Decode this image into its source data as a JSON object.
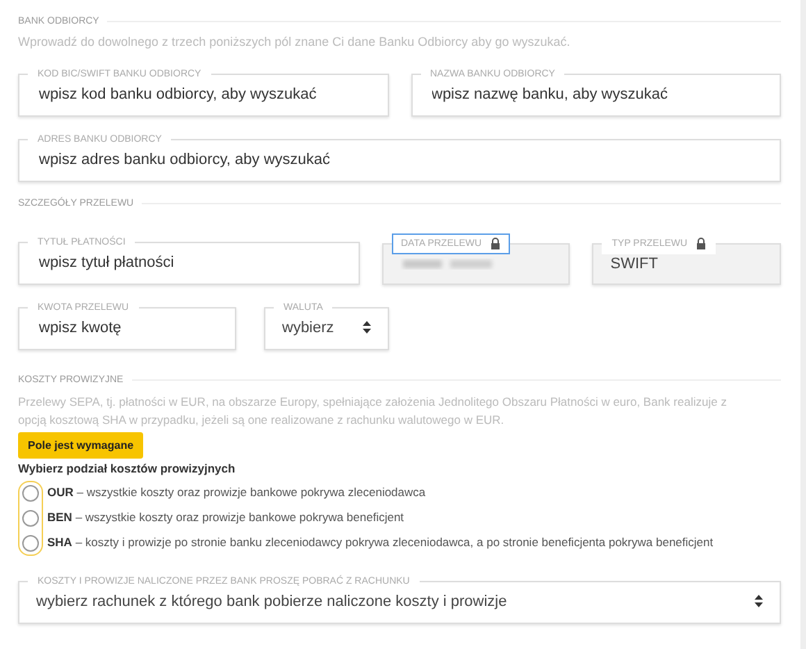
{
  "sections": [
    {
      "title": "BANK ODBIORCY",
      "hint": "Wprowadź do dowolnego z trzech poniższych pól znane Ci dane Banku Odbiorcy aby go wyszukać.",
      "rows": [
        [
          {
            "kind": "text",
            "label": "KOD BIC/SWIFT BANKU ODBIORCY",
            "placeholder": "wpisz kod banku odbiorcy, aby wyszukać",
            "locked": false,
            "focused": false
          },
          {
            "kind": "text",
            "label": "NAZWA BANKU ODBIORCY",
            "placeholder": "wpisz nazwę banku, aby wyszukać",
            "locked": false,
            "focused": false
          }
        ],
        [
          {
            "kind": "text",
            "label": "ADRES BANKU ODBIORCY",
            "placeholder": "wpisz adres banku odbiorcy, aby wyszukać",
            "locked": false,
            "focused": false
          }
        ]
      ]
    },
    {
      "title": "SZCZEGÓŁY PRZELEWU",
      "rows": [
        [
          {
            "kind": "text",
            "label": "TYTUŁ PŁATNOŚCI",
            "placeholder": "wpisz tytuł płatności",
            "locked": false,
            "focused": false
          },
          {
            "kind": "redacted",
            "label": "DATA PRZELEWU",
            "locked": true,
            "focused": true
          },
          {
            "kind": "readonly",
            "label": "TYP PRZELEWU",
            "value": "SWIFT",
            "locked": true,
            "focused": false
          }
        ],
        [
          {
            "kind": "text",
            "label": "KWOTA PRZELEWU",
            "placeholder": "wpisz kwotę",
            "locked": false,
            "focused": false
          },
          {
            "kind": "select",
            "label": "WALUTA",
            "value": "wybierz",
            "locked": false,
            "focused": false
          }
        ]
      ]
    }
  ],
  "costs": {
    "title": "KOSZTY PROWIZYJNE",
    "note": "Przelewy SEPA, tj. płatności w EUR, na obszarze Europy, spełniające założenia Jednolitego Obszaru Płatności w euro, Bank realizuje z opcją kosztową SHA w przypadku, jeżeli są one realizowane z rachunku walutowego w EUR.",
    "tooltip": "Pole jest wymagane",
    "question": "Wybierz podział kosztów prowizyjnych",
    "required_error": true,
    "options": [
      {
        "code": "OUR",
        "text": "– wszystkie koszty oraz prowizje bankowe pokrywa zleceniodawca",
        "selected": false
      },
      {
        "code": "BEN",
        "text": "– wszystkie koszty oraz prowizje bankowe pokrywa beneficjent",
        "selected": false
      },
      {
        "code": "SHA",
        "text": "– koszty i prowizje po stronie banku zleceniodawcy pokrywa zleceniodawca, a po stronie beneficjenta pokrywa beneficjent",
        "selected": false
      }
    ],
    "account": {
      "kind": "select",
      "label": "KOSZTY I PROWIZJE NALICZONE PRZEZ BANK PROSZĘ POBRAĆ Z RACHUNKU",
      "value": "wybierz rachunek z którego bank pobierze naliczone koszty i prowizje",
      "locked": false,
      "focused": false
    }
  }
}
